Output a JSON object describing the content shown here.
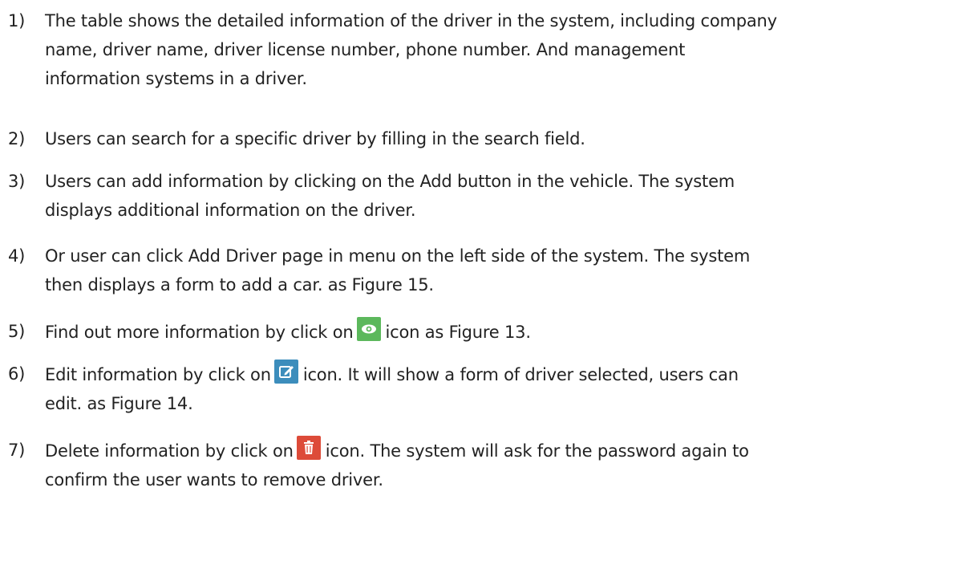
{
  "items": [
    {
      "number": "1)",
      "lines": [
        "The table shows the detailed information of the driver in the system, including company",
        "name, driver name, driver license number, phone number. And management",
        "information systems in a driver."
      ]
    },
    {
      "number": "2)",
      "lines": [
        "Users can search for a specific driver by filling in the search field."
      ]
    },
    {
      "number": "3)",
      "lines": [
        "Users can add information by clicking on the Add button in the vehicle. The system",
        "displays additional information on the driver."
      ]
    },
    {
      "number": "4)",
      "lines": [
        "Or user can click Add Driver page in menu on the left side of the system. The system",
        "then displays a form to add a car. as Figure 15."
      ]
    },
    {
      "number": "5)",
      "before_icon": "Find out more information by click on",
      "icon": "eye-icon",
      "after_icon": "icon as Figure 13."
    },
    {
      "number": "6)",
      "before_icon": "Edit information by click on",
      "icon": "edit-icon",
      "after_icon": "icon. It will show a form of driver selected, users can",
      "lines": [
        "edit. as Figure 14."
      ]
    },
    {
      "number": "7)",
      "before_icon": "Delete information by click on",
      "icon": "trash-icon",
      "after_icon": "icon. The system will ask for the password again to",
      "lines": [
        "confirm the user wants to remove driver."
      ]
    }
  ],
  "colors": {
    "view_icon": "#5cb85c",
    "edit_icon": "#3c8dbc",
    "delete_icon": "#dd4b39"
  }
}
